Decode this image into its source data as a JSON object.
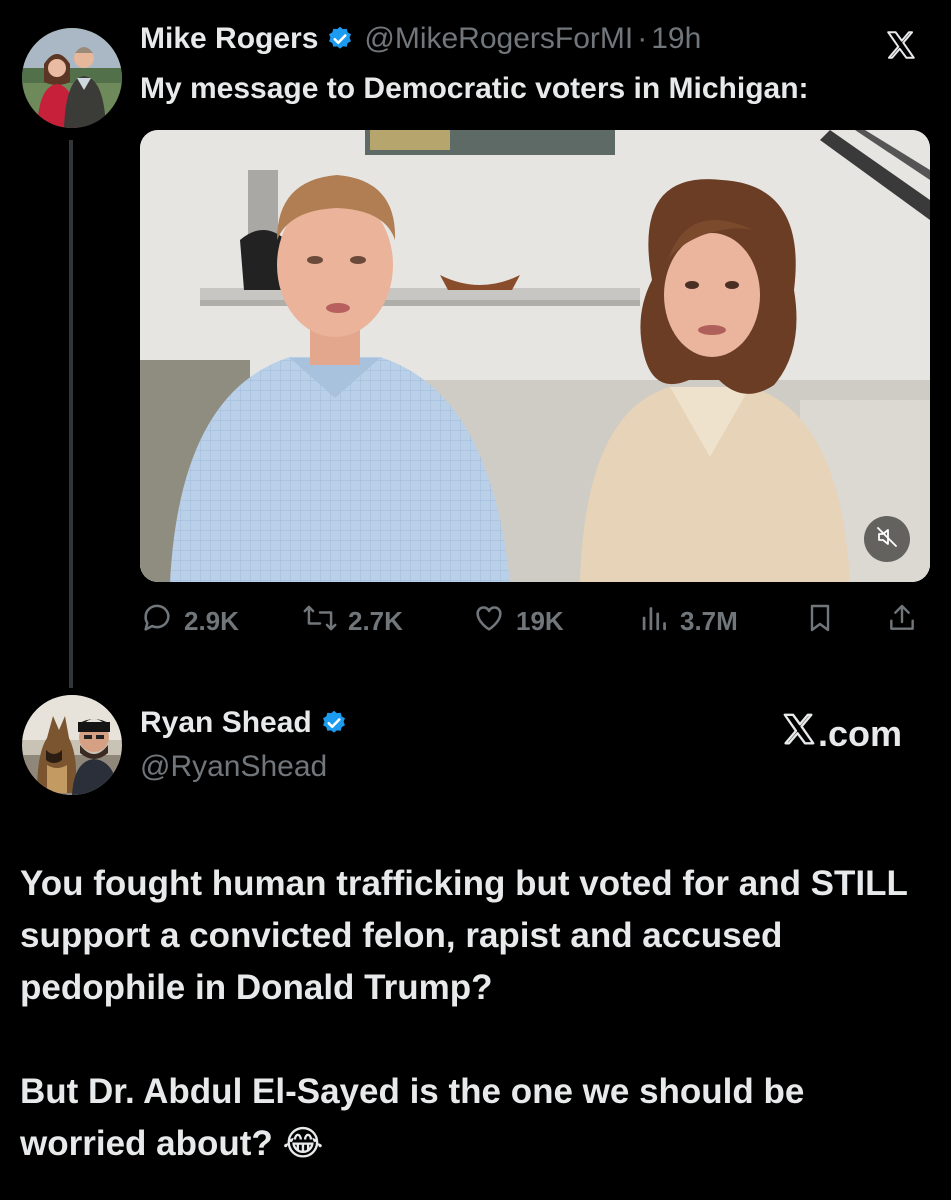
{
  "tweet": {
    "author_name": "Mike Rogers",
    "handle": "@MikeRogersForMI",
    "separator": "·",
    "time": "19h",
    "text": "My message to Democratic voters in Michigan:",
    "media": {
      "type": "video",
      "muted": true
    },
    "stats": {
      "replies": "2.9K",
      "reposts": "2.7K",
      "likes": "19K",
      "views": "3.7M"
    }
  },
  "reply": {
    "author_name": "Ryan Shead",
    "handle": "@RyanShead",
    "site_suffix": ".com",
    "paragraph1": "You fought human trafficking but voted for and STILL support a convicted felon, rapist and accused pedophile in Donald Trump?",
    "paragraph2": "But Dr. Abdul El-Sayed is the one we should be worried about?",
    "emoji": "😂"
  },
  "colors": {
    "background": "#000000",
    "primary_text": "#e7e9ea",
    "secondary_text": "#71767b",
    "verified_blue": "#1d9bf0"
  }
}
